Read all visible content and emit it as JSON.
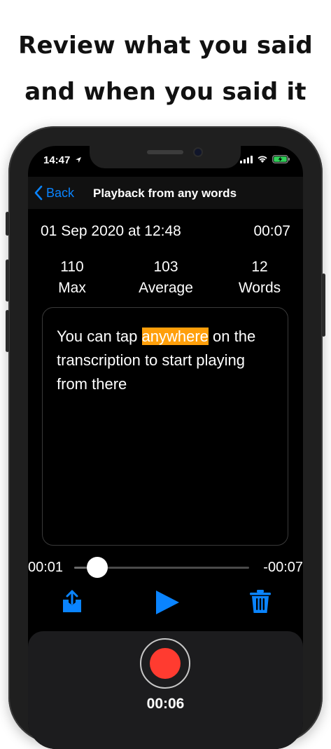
{
  "headline": {
    "line1": "Review what you said",
    "line2": "and when you said it"
  },
  "status_bar": {
    "time": "14:47"
  },
  "nav": {
    "back_label": "Back",
    "title": "Playback from any words"
  },
  "recording": {
    "date": "01 Sep 2020 at 12:48",
    "duration": "00:07",
    "stats": [
      {
        "value": "110",
        "label": "Max"
      },
      {
        "value": "103",
        "label": "Average"
      },
      {
        "value": "12",
        "label": "Words"
      }
    ]
  },
  "transcript": {
    "before": "You can tap ",
    "highlight": "anywhere",
    "after": " on the transcription to start playing from there",
    "highlight_color": "#ff9f0a"
  },
  "playback": {
    "current": "00:01",
    "remaining": "-00:07",
    "progress": 0.13
  },
  "controls": {
    "share_icon": "share-icon",
    "play_icon": "play-icon",
    "delete_icon": "trash-icon",
    "accent": "#0a84ff"
  },
  "recorder": {
    "time": "00:06",
    "record_color": "#ff3b30"
  }
}
